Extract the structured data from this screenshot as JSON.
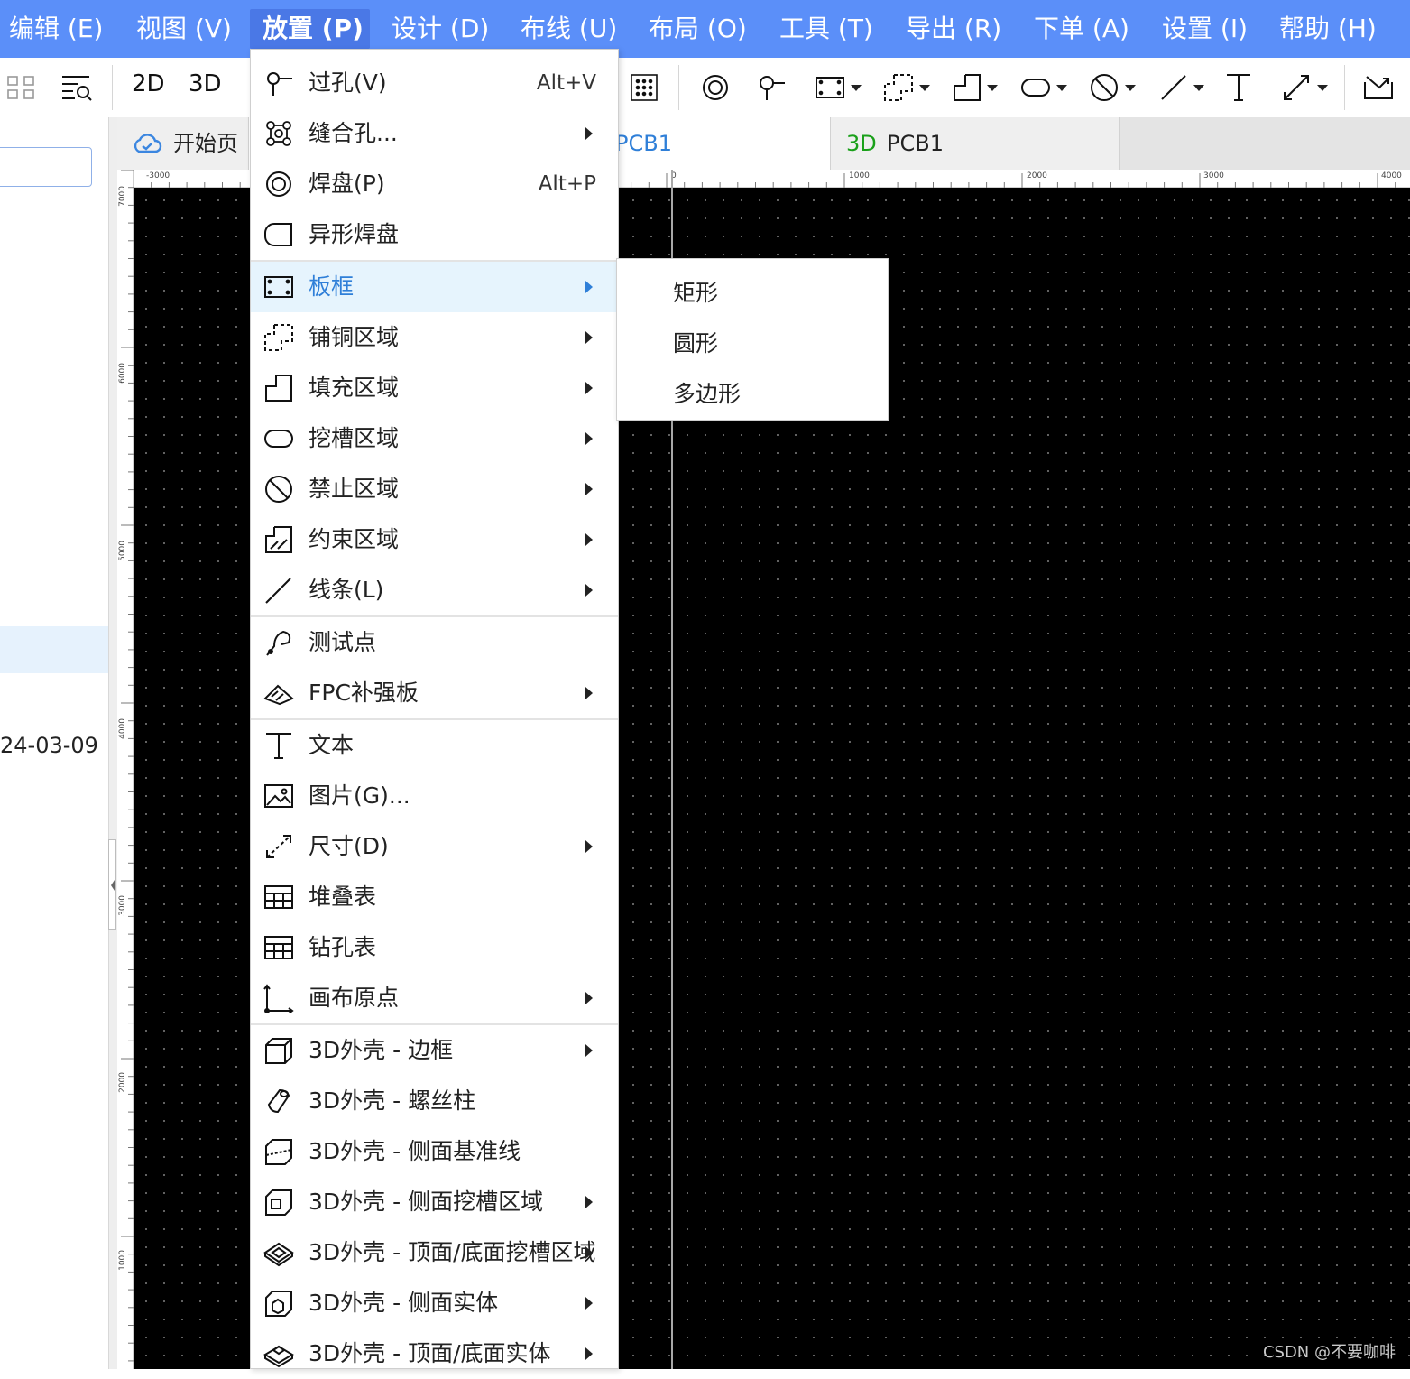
{
  "menubar": {
    "items": [
      {
        "label": "编辑 (E)"
      },
      {
        "label": "视图 (V)"
      },
      {
        "label": "放置 (P)",
        "active": true
      },
      {
        "label": "设计 (D)"
      },
      {
        "label": "布线 (U)"
      },
      {
        "label": "布局 (O)"
      },
      {
        "label": "工具 (T)"
      },
      {
        "label": "导出 (R)"
      },
      {
        "label": "下单 (A)"
      },
      {
        "label": "设置 (I)"
      },
      {
        "label": "帮助 (H)"
      }
    ]
  },
  "toolbar": {
    "view_2d": "2D",
    "view_3d": "3D",
    "icons": [
      "grid-view-icon",
      "search-list-icon",
      "copper-grid-icon",
      "pad-icon",
      "via-icon",
      "board-frame-icon",
      "copper-area-icon",
      "fill-area-icon",
      "slot-area-icon",
      "keepout-icon",
      "line-icon",
      "text-icon",
      "dimension-icon",
      "import-icon"
    ]
  },
  "left_panel": {
    "date": "24-03-09"
  },
  "tabs": [
    {
      "label": "开始页",
      "icon": "cloud-icon"
    },
    {
      "label": "PCB1"
    },
    {
      "label": "PCB1",
      "prefix": "3D"
    }
  ],
  "ruler": {
    "top_labels": [
      "-3000",
      "0",
      "1000",
      "2000",
      "3000",
      "4000"
    ],
    "left_labels": [
      "7000",
      "6000",
      "5000",
      "4000",
      "3000",
      "2000",
      "1000"
    ]
  },
  "place_menu": {
    "items": [
      {
        "label": "过孔(V)",
        "shortcut": "Alt+V",
        "icon": "via-icon"
      },
      {
        "label": "缝合孔...",
        "submenu": true,
        "icon": "stitching-via-icon"
      },
      {
        "label": "焊盘(P)",
        "shortcut": "Alt+P",
        "icon": "pad-icon"
      },
      {
        "label": "异形焊盘",
        "icon": "custom-pad-icon"
      },
      {
        "label": "板框",
        "submenu": true,
        "highlighted": true,
        "icon": "board-frame-icon"
      },
      {
        "label": "铺铜区域",
        "submenu": true,
        "icon": "copper-area-icon"
      },
      {
        "label": "填充区域",
        "submenu": true,
        "icon": "fill-area-icon"
      },
      {
        "label": "挖槽区域",
        "submenu": true,
        "icon": "slot-area-icon"
      },
      {
        "label": "禁止区域",
        "submenu": true,
        "icon": "keepout-icon"
      },
      {
        "label": "约束区域",
        "submenu": true,
        "icon": "constraint-area-icon"
      },
      {
        "label": "线条(L)",
        "submenu": true,
        "icon": "line-icon"
      },
      {
        "label": "测试点",
        "icon": "test-point-icon"
      },
      {
        "label": "FPC补强板",
        "submenu": true,
        "icon": "fpc-stiffener-icon"
      },
      {
        "label": "文本",
        "icon": "text-icon"
      },
      {
        "label": "图片(G)...",
        "icon": "image-icon"
      },
      {
        "label": "尺寸(D)",
        "submenu": true,
        "icon": "dimension-icon"
      },
      {
        "label": "堆叠表",
        "icon": "table-icon"
      },
      {
        "label": "钻孔表",
        "icon": "table-icon"
      },
      {
        "label": "画布原点",
        "submenu": true,
        "icon": "origin-icon"
      },
      {
        "label": "3D外壳 - 边框",
        "submenu": true,
        "icon": "cube-icon"
      },
      {
        "label": "3D外壳 - 螺丝柱",
        "icon": "screw-post-icon"
      },
      {
        "label": "3D外壳 - 侧面基准线",
        "icon": "side-baseline-icon"
      },
      {
        "label": "3D外壳 - 侧面挖槽区域",
        "submenu": true,
        "icon": "side-slot-icon"
      },
      {
        "label": "3D外壳 - 顶面/底面挖槽区域",
        "submenu": true,
        "icon": "top-slot-icon"
      },
      {
        "label": "3D外壳 - 侧面实体",
        "submenu": true,
        "icon": "side-solid-icon"
      },
      {
        "label": "3D外壳 - 顶面/底面实体",
        "submenu": true,
        "icon": "top-solid-icon"
      }
    ]
  },
  "board_frame_submenu": {
    "items": [
      {
        "label": "矩形"
      },
      {
        "label": "圆形"
      },
      {
        "label": "多边形"
      }
    ]
  },
  "watermark": "CSDN @不要咖啡",
  "colors": {
    "menubar": "#5b8ff9",
    "highlight": "#e6f4fd",
    "highlight_text": "#2f7fd8",
    "canvas": "#000000",
    "tab_3d_prefix": "#1aa01a"
  }
}
